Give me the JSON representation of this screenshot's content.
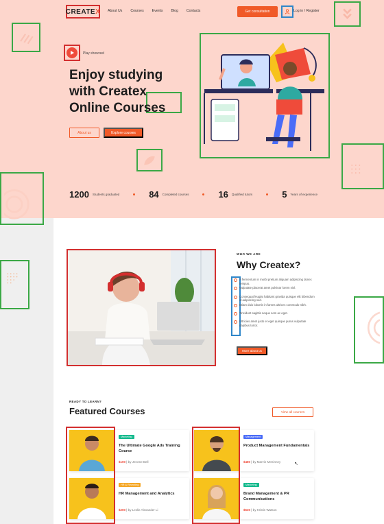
{
  "header": {
    "logo": {
      "text_main": "CREATE",
      "text_accent": "X"
    },
    "nav": [
      "About Us",
      "Courses",
      "Events",
      "Blog",
      "Contacts"
    ],
    "consult_button": "Get consultation",
    "login": "Log in / Register"
  },
  "hero": {
    "play_label": "Play showreel",
    "title_lines": [
      "Enjoy studying",
      "with Createx",
      "Online Courses"
    ],
    "about_button": "About us",
    "explore_button": "Explore courses"
  },
  "stats": [
    {
      "number": "1200",
      "label": "Students graduated"
    },
    {
      "number": "84",
      "label": "Completed courses"
    },
    {
      "number": "16",
      "label": "Qualified tutors"
    },
    {
      "number": "5",
      "label": "Years of experience"
    }
  ],
  "why": {
    "kicker": "WHO WE ARE",
    "title": "Why Createx?",
    "items": [
      "A fermentum in morbi pretium aliquam adipiscing donec tempus.",
      "Vulputate placerat amet pulvinar lorem nisl.",
      "Consequat feugiat habitant gravida quisque elit bibendum id adipiscing sed.",
      "Etiam duis lobortis in fames ultrices commodo nibh.",
      "Tincidunt sagittis neque sem ac eget.",
      "Ultricies amet justo et eget quisque purus vulputate dapibus tortor."
    ],
    "more_button": "More about us"
  },
  "featured": {
    "kicker": "READY TO LEARN?",
    "title": "Featured Courses",
    "view_all": "View all courses",
    "courses": [
      {
        "tag": "Marketing",
        "tag_color": "#12b98c",
        "title": "The Ultimate Google Ads Training Course",
        "price": "$100",
        "author": "| by Jerome Bell"
      },
      {
        "tag": "Management",
        "tag_color": "#4a6cf7",
        "title": "Product Management Fundamentals",
        "price": "$480",
        "author": "| by Marvin McKinney"
      },
      {
        "tag": "HR & Recruting",
        "tag_color": "#f5a623",
        "title": "HR  Management and Analytics",
        "price": "$200",
        "author": "| by Leslie Alexander Li"
      },
      {
        "tag": "Marketing",
        "tag_color": "#12b98c",
        "title": "Brand Management & PR Communications",
        "price": "$530",
        "author": "| by Kristin Watson"
      }
    ]
  },
  "colors": {
    "accent": "#f05a28",
    "hero_bg": "#fdd6cc",
    "annotation_red": "#d32f2f",
    "annotation_green": "#3aa845",
    "annotation_blue": "#2e86c9"
  }
}
